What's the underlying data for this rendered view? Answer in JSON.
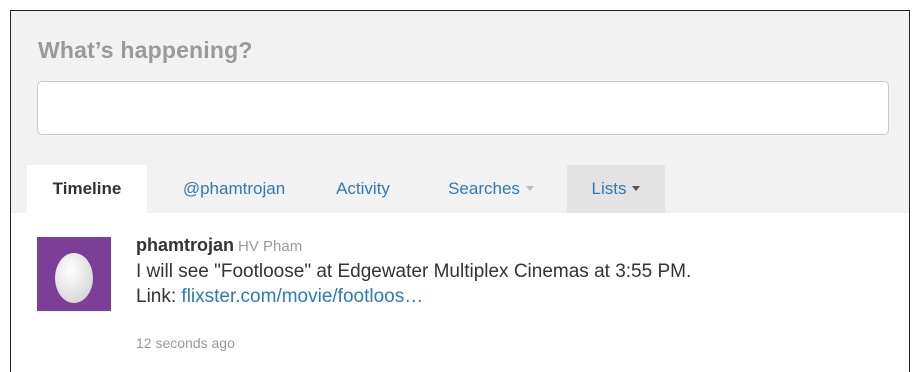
{
  "composer": {
    "prompt": "What’s happening?",
    "value": "",
    "placeholder": ""
  },
  "tabs": [
    {
      "label": "Timeline",
      "active": true
    },
    {
      "label": "@phamtrojan",
      "active": false
    },
    {
      "label": "Activity",
      "active": false
    },
    {
      "label": "Searches",
      "active": false,
      "dropdown": true
    },
    {
      "label": "Lists",
      "active": false,
      "dropdown": true
    }
  ],
  "tweet": {
    "screen_name": "phamtrojan",
    "real_name": "HV Pham",
    "text_line1": "I will see \"Footloose\" at Edgewater Multiplex Cinemas at 3:55 PM.",
    "link_prefix": "Link: ",
    "link_text": "flixster.com/movie/footloos…",
    "timestamp": "12 seconds ago",
    "avatar_icon": "egg-icon",
    "avatar_color": "#7b3f98"
  },
  "colors": {
    "link": "#2b7bb9",
    "background": "#f2f2f2",
    "muted": "#999999"
  }
}
